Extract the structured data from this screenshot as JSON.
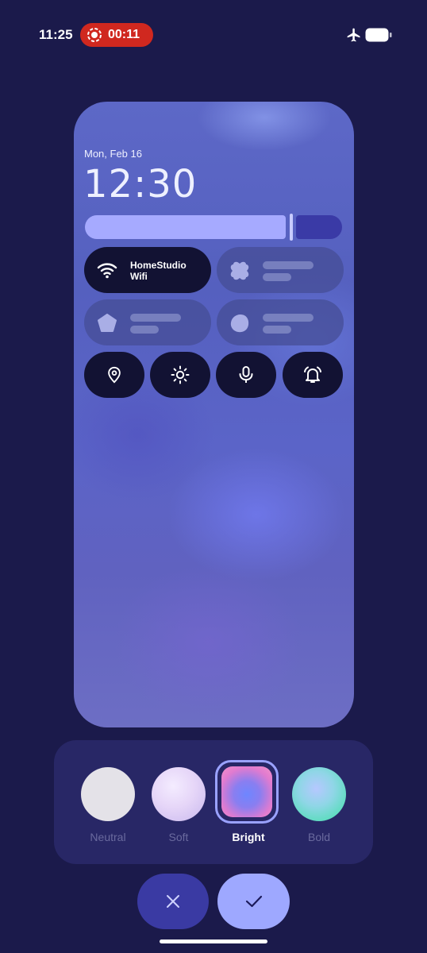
{
  "status_bar": {
    "time": "11:25",
    "recording_time": "00:11",
    "icons": [
      "record-icon",
      "airplane-icon",
      "battery-icon"
    ]
  },
  "preview": {
    "date": "Mon, Feb 16",
    "clock": "12:30",
    "brightness_level": 0.78,
    "wifi_tile": {
      "title": "HomeStudio",
      "subtitle": "Wifi",
      "icon": "wifi-icon"
    },
    "placeholder_tile_icons": [
      "clover-shape-icon",
      "pentagon-shape-icon",
      "blob-shape-icon"
    ],
    "small_tile_icons": [
      "location-pin-icon",
      "brightness-icon",
      "microphone-icon",
      "alarm-icon"
    ]
  },
  "picker": {
    "options": [
      {
        "label": "Neutral"
      },
      {
        "label": "Soft"
      },
      {
        "label": "Bright"
      },
      {
        "label": "Bold"
      }
    ],
    "selected": "Bright"
  },
  "actions": {
    "cancel_icon": "close-icon",
    "apply_icon": "check-icon"
  },
  "colors": {
    "background": "#1b1a4b",
    "accent": "#9ea8ff",
    "recording": "#d0281f"
  }
}
